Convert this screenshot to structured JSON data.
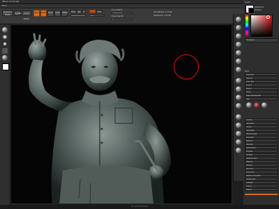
{
  "app": {
    "title": "ZBrush 4.0 [Sculpt]",
    "menu_label": "Menu"
  },
  "toolbar": {
    "projection_master": "Projection Master",
    "lightbox": "LightBox",
    "quick_sketch": "Quick Sketch",
    "edit": "Edit",
    "draw": "Draw",
    "move": "Move",
    "scale": "Scale",
    "rotate": "Rotate",
    "mrgb": "Mrgb",
    "rgb": "Rgb",
    "m": "M",
    "zadd": "Zadd",
    "zsub": "Zsub",
    "focal_shift_label": "Focal Shift",
    "focal_shift_value": 0,
    "z_intensity_label": "Z Intensity",
    "z_intensity_value": 25,
    "draw_size_label": "Draw Size",
    "draw_size_value": 64,
    "active_points": "ActivePoints: 1.55 Mil",
    "total_points": "TotalPoints: 1.55 Mil",
    "rgb_intensity": 100
  },
  "panel": {
    "color_label": "Color",
    "rows": [
      "SwitchColor",
      "Gradient",
      "Fill Object",
      "Subtool",
      "Tool",
      "Load Tool",
      "Save As",
      "Copy Tool",
      "Import",
      "Export",
      "Clone",
      "Make PolyMesh3D",
      "GoZ",
      "All",
      "Visible",
      "Lightbox Tools",
      "Polymesh3D",
      "SubTool",
      "Geometry",
      "Layers",
      "FiberMesh",
      "Morph Target",
      "Polypaint",
      "Masking",
      "Visibility",
      "Deformation",
      "Preview",
      "Surface",
      "Adaptive Skin",
      "ZSketch",
      "Rigging",
      "Topology",
      "Projection",
      "Display Properties",
      "Unified Skin",
      "Initialize",
      "Import",
      "Export"
    ],
    "accent_color": "#d56a1e"
  },
  "status": {
    "text": "Vincent_Soft Sculpt"
  }
}
